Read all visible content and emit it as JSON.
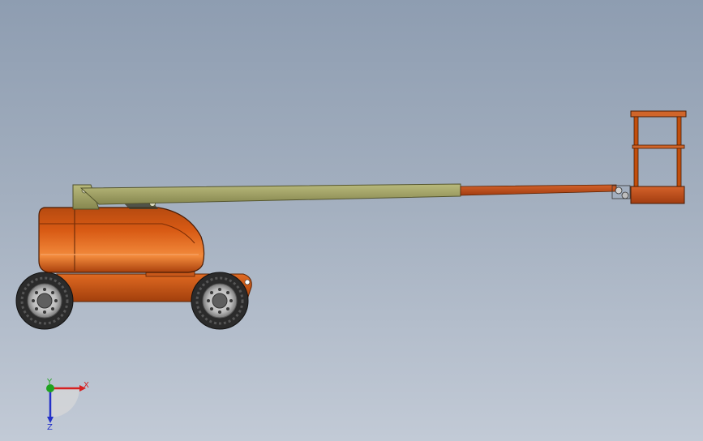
{
  "viewport": {
    "view": "cad-3d-model-side-view"
  },
  "model": {
    "name": "boom-lift",
    "colors": {
      "body": "#c24e0c",
      "body_highlight": "#f07a2a",
      "boom": "#9d9e62",
      "boom_dark": "#6f7043",
      "boom_extension": "#b94a16",
      "tire": "#2b2b2b",
      "rim": "#cfcfcf",
      "platform": "#c24e0c"
    }
  },
  "triad": {
    "x_label": "X",
    "y_label": "Y",
    "z_label": "Z",
    "x_color": "#d62020",
    "y_color": "#1fa31f",
    "z_color": "#2431c8"
  }
}
